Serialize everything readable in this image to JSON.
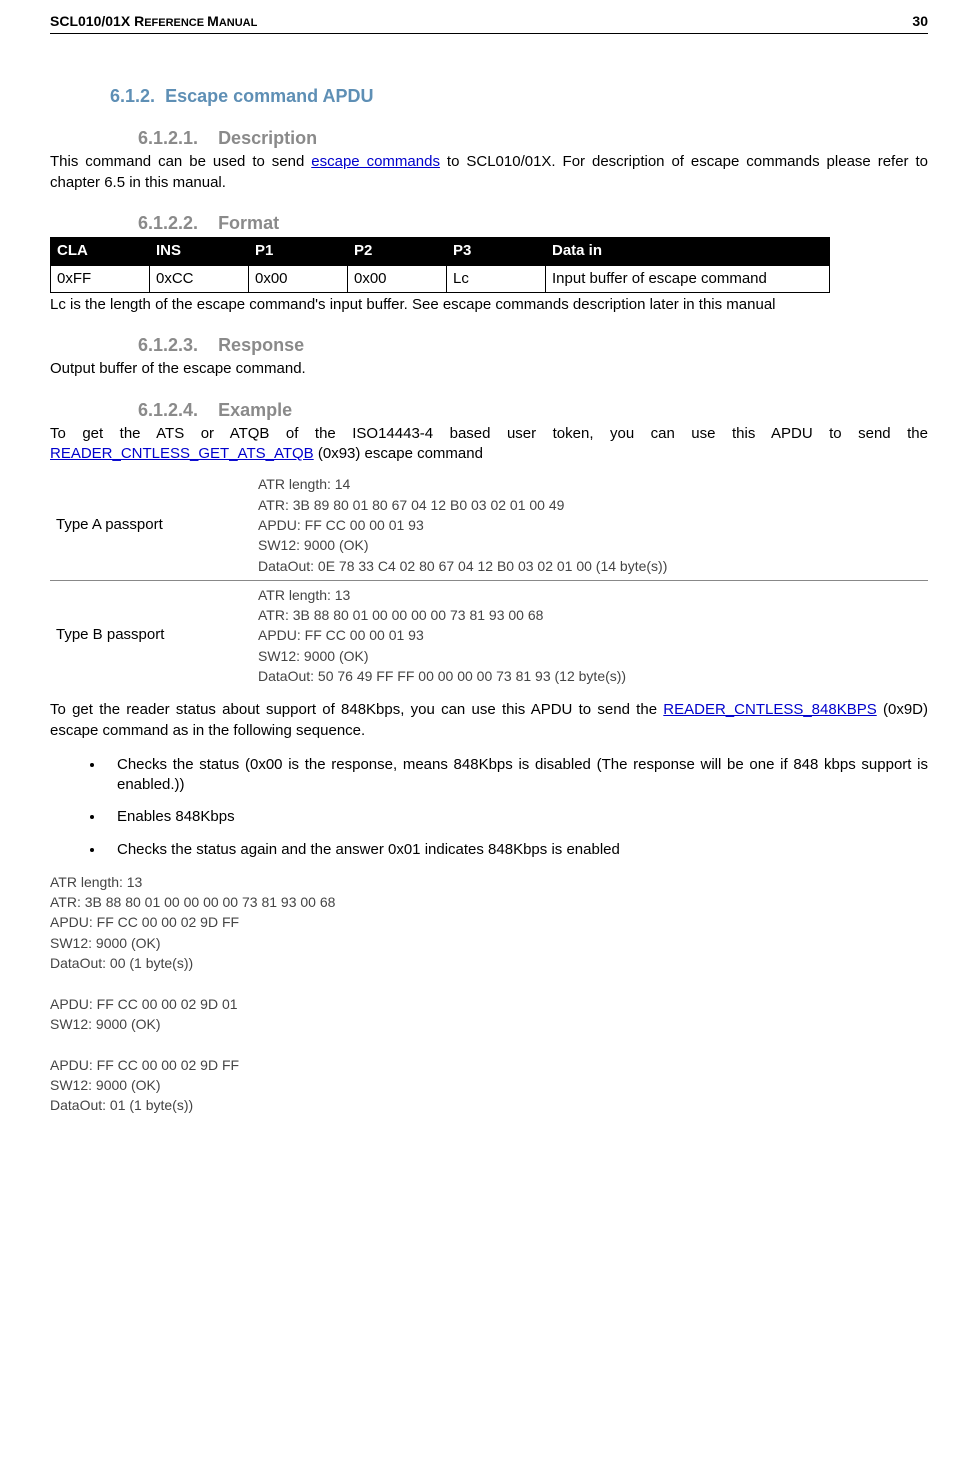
{
  "header": {
    "title_prefix": "SCL010/01X ",
    "title_rest_caps": "R",
    "title_rest_sc": "EFERENCE ",
    "title_rest_caps2": "M",
    "title_rest_sc2": "ANUAL",
    "page_num": "30"
  },
  "sec612": {
    "num": "6.1.2.",
    "title": "Escape command APDU"
  },
  "sec6121": {
    "num": "6.1.2.1.",
    "title": "Description",
    "p1a": "This command can be used to send ",
    "link1": "escape commands",
    "p1b": " to SCL010/01X. For description of escape commands please refer to chapter 6.5 in this manual."
  },
  "sec6122": {
    "num": "6.1.2.2.",
    "title": "Format",
    "th": [
      "CLA",
      "INS",
      "P1",
      "P2",
      "P3",
      "Data in"
    ],
    "row": [
      "0xFF",
      "0xCC",
      "0x00",
      "0x00",
      "Lc",
      "Input buffer of escape command"
    ],
    "note": "Lc is the length of the escape command's input buffer. See escape commands description later in this manual"
  },
  "sec6123": {
    "num": "6.1.2.3.",
    "title": "Response",
    "p": "Output buffer of the escape command."
  },
  "sec6124": {
    "num": "6.1.2.4.",
    "title": "Example",
    "p1a": "To get the ATS or ATQB of the ISO14443-4 based user token, you can use this APDU to send the ",
    "link1": "READER_CNTLESS_GET_ATS_ATQB",
    "p1b": " (0x93) escape command",
    "rowA_label": "Type A passport",
    "rowA_code": "ATR length: 14\nATR: 3B 89 80 01 80 67 04 12 B0 03 02 01 00 49\nAPDU: FF CC 00 00 01 93\nSW12: 9000 (OK)\nDataOut: 0E 78 33 C4 02 80 67 04 12 B0 03 02 01 00 (14 byte(s))",
    "rowB_label": "Type B passport",
    "rowB_code": "ATR length: 13\nATR: 3B 88 80 01 00 00 00 00 73 81 93 00 68\nAPDU: FF CC 00 00 01 93\nSW12: 9000 (OK)\nDataOut: 50 76 49 FF FF 00 00 00 00 73 81 93 (12 byte(s))",
    "p2a": "To get the reader status about support of 848Kbps, you can use this APDU to send the ",
    "link2": "READER_CNTLESS_848KBPS",
    "p2b": " (0x9D) escape command as in the following sequence.",
    "bullets": [
      "Checks the status (0x00 is the response, means 848Kbps is disabled (The response will be one if  848 kbps support is enabled.))",
      "Enables 848Kbps",
      "Checks the status again and the answer 0x01 indicates 848Kbps is enabled"
    ],
    "code2": "ATR length: 13\nATR: 3B 88 80 01 00 00 00 00 73 81 93 00 68\nAPDU: FF CC 00 00 02 9D FF\nSW12: 9000 (OK)\nDataOut: 00 (1 byte(s))\n\nAPDU: FF CC 00 00 02 9D 01\nSW12: 9000 (OK)\n\nAPDU: FF CC 00 00 02 9D FF\nSW12: 9000 (OK)\nDataOut: 01 (1 byte(s))"
  }
}
